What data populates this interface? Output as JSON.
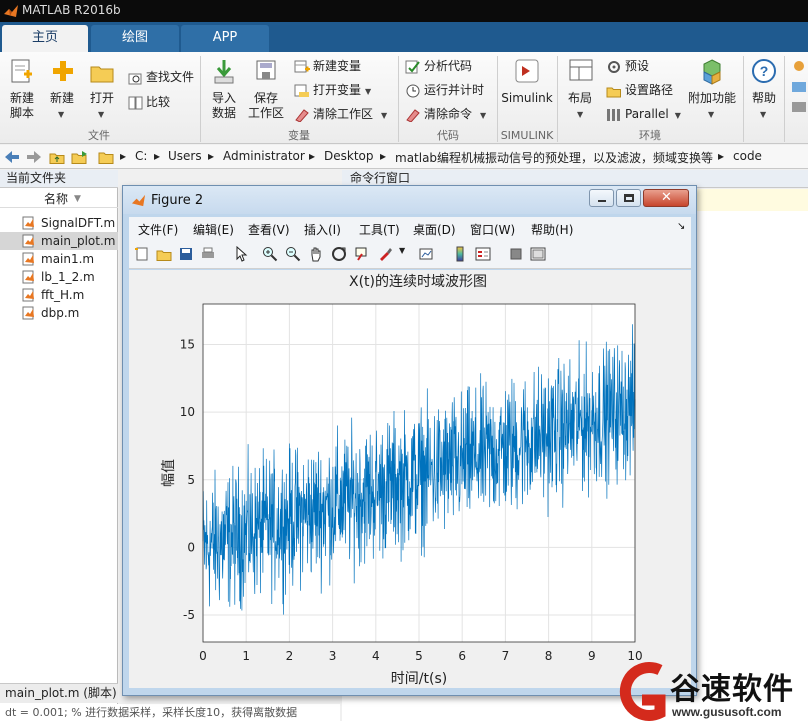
{
  "app": {
    "title": "MATLAB R2016b"
  },
  "tabs": [
    {
      "label": "主页"
    },
    {
      "label": "绘图"
    },
    {
      "label": "APP"
    }
  ],
  "ribbon": {
    "file": {
      "new_script": "新建\n脚本",
      "new": "新建",
      "open": "打开",
      "find_files": "查找文件",
      "compare": "比较",
      "section": "文件"
    },
    "variable": {
      "import": "导入\n数据",
      "save_ws": "保存\n工作区",
      "new_var": "新建变量",
      "open_var": "打开变量",
      "clear_ws": "清除工作区",
      "section": "变量"
    },
    "code": {
      "analyze": "分析代码",
      "run_time": "运行并计时",
      "clear_cmd": "清除命令",
      "section": "代码"
    },
    "simulink": {
      "label": "Simulink",
      "section": "SIMULINK"
    },
    "env": {
      "layout": "布局",
      "prefs": "预设",
      "set_path": "设置路径",
      "parallel": "Parallel",
      "addons": "附加功能",
      "section": "环境"
    },
    "help": {
      "label": "帮助"
    }
  },
  "address": {
    "crumbs": [
      "C:",
      "Users",
      "Administrator",
      "Desktop",
      "matlab编程机械振动信号的预处理，以及滤波，频域变换等",
      "code"
    ]
  },
  "current_folder": {
    "title": "当前文件夹",
    "column": "名称",
    "files": [
      "SignalDFT.m",
      "main_plot.m",
      "main1.m",
      "lb_1_2.m",
      "fft_H.m",
      "dbp.m"
    ],
    "selected": "main_plot.m",
    "status": "main_plot.m  (脚本)"
  },
  "command_window": {
    "title": "命令行窗口"
  },
  "bottom": {
    "text": "dt = 0.001;   % 进行数据采样，采样长度10，获得离散数据"
  },
  "figure": {
    "title": "Figure 2",
    "menu": [
      "文件(F)",
      "编辑(E)",
      "查看(V)",
      "插入(I)",
      "工具(T)",
      "桌面(D)",
      "窗口(W)",
      "帮助(H)"
    ]
  },
  "watermark": {
    "brand": "谷速软件",
    "url": "www.gususoft.com"
  },
  "colors": {
    "line": "#0072bd",
    "tabbar": "#1f5a8f",
    "ribbon": "#f4f4f4"
  },
  "chart_data": {
    "type": "line",
    "title": "X(t)的连续时域波形图",
    "xlabel": "时间/t(s)",
    "ylabel": "幅值",
    "xlim": [
      0,
      10
    ],
    "ylim": [
      -7,
      18
    ],
    "xticks": [
      0,
      1,
      2,
      3,
      4,
      5,
      6,
      7,
      8,
      9,
      10
    ],
    "yticks": [
      -5,
      0,
      5,
      10,
      15
    ],
    "grid": true,
    "series": [
      {
        "trend_start": 0.0,
        "trend_end": 10.5,
        "noise_amplitude": 6.5,
        "values_x": [
          0,
          10
        ]
      }
    ]
  }
}
